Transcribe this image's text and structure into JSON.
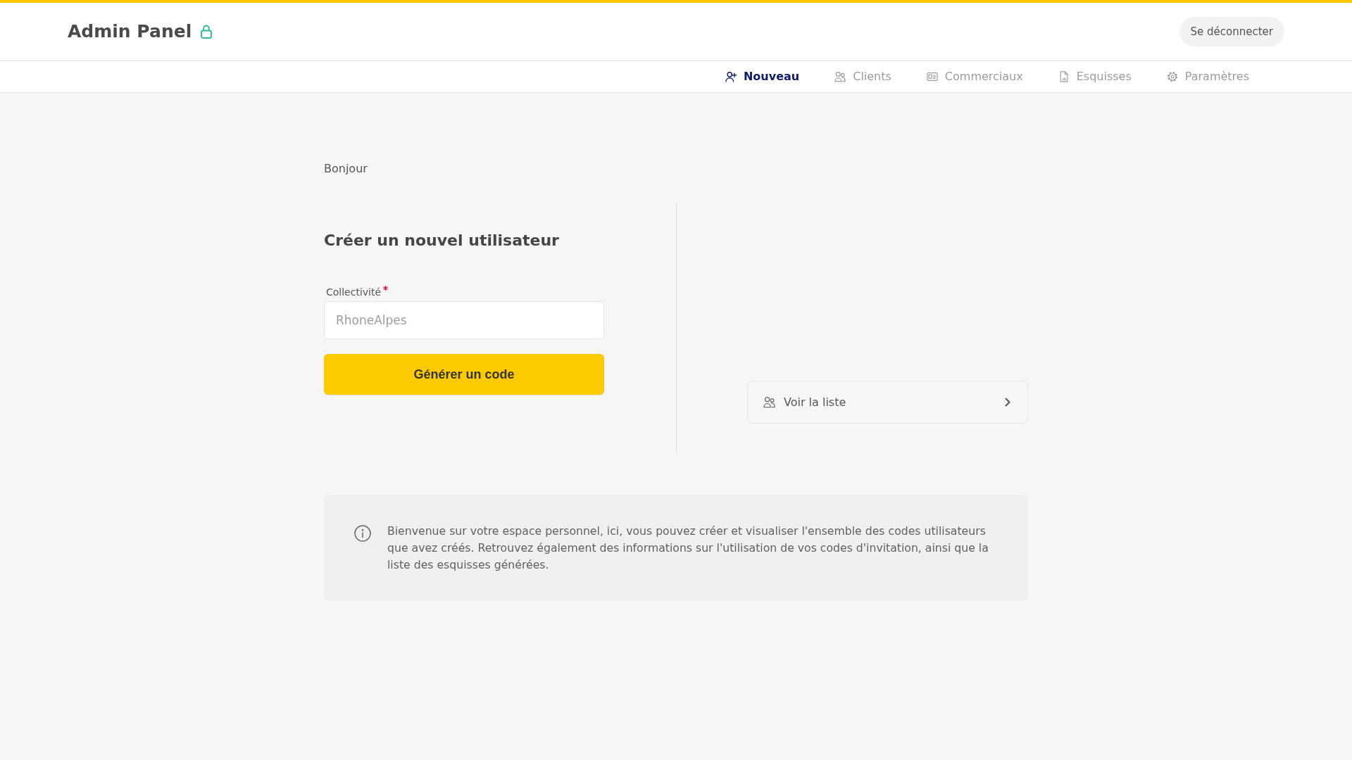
{
  "header": {
    "title": "Admin Panel",
    "logout_button": "Se déconnecter"
  },
  "nav": {
    "tabs": [
      {
        "label": "Nouveau",
        "selected": true
      },
      {
        "label": "Clients",
        "selected": false
      },
      {
        "label": "Commerciaux",
        "selected": false
      },
      {
        "label": "Esquisses",
        "selected": false
      },
      {
        "label": "Paramètres",
        "selected": false
      }
    ]
  },
  "greeting": "Bonjour",
  "create_form": {
    "title": "Créer un nouvel utilisateur",
    "field": {
      "label": "Collectivité",
      "required": true,
      "placeholder": "RhoneAlpes"
    },
    "submit_button": "Générer un code"
  },
  "list_link": {
    "label": "Voir la liste"
  },
  "info": {
    "text": "Bienvenue sur votre espace personnel, ici, vous pouvez créer et visualiser l'ensemble des codes utilisateurs que avez créés. Retrouvez également des informations sur l'utilisation de vos codes d'invitation, ainsi que la liste des esquisses générées."
  }
}
